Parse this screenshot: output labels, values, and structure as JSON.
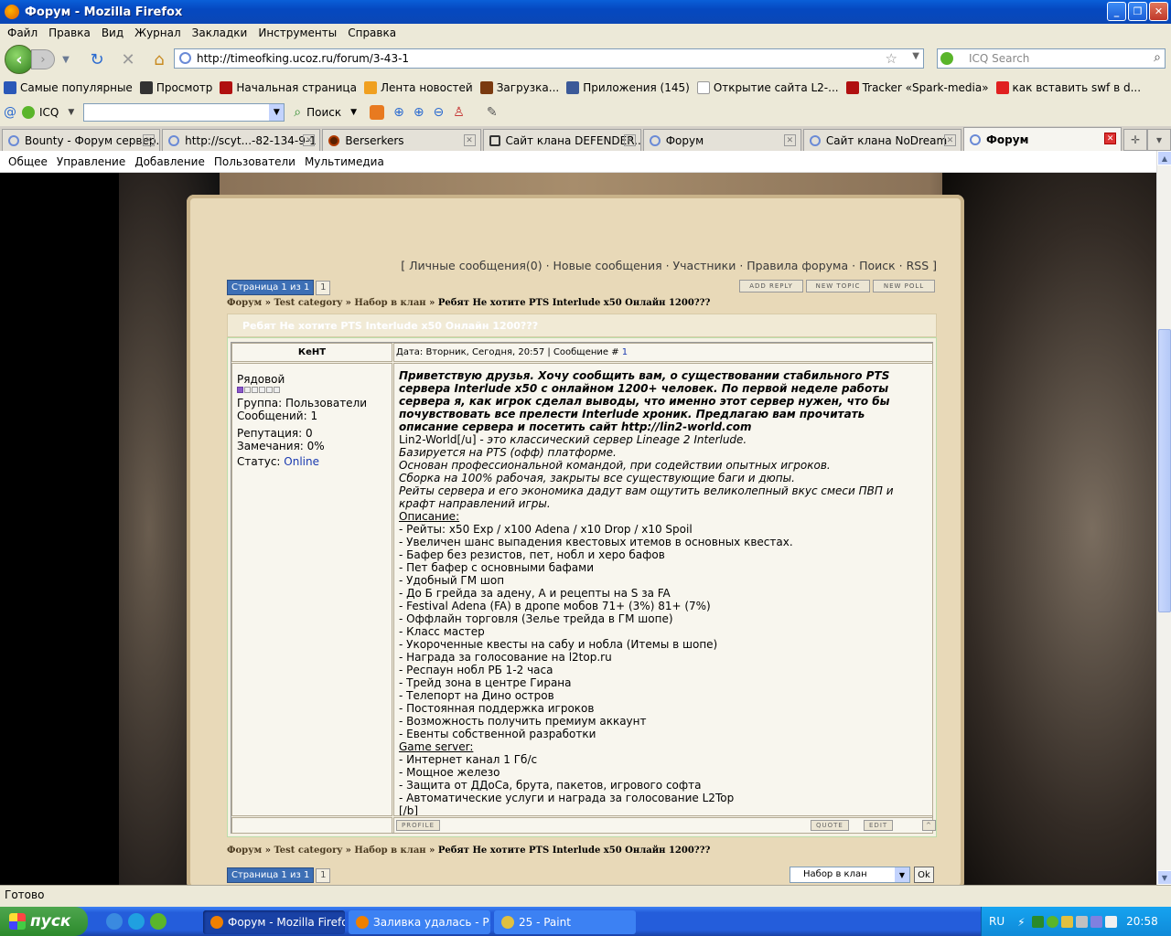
{
  "window": {
    "title": "Форум - Mozilla Firefox"
  },
  "menu": [
    "Файл",
    "Правка",
    "Вид",
    "Журнал",
    "Закладки",
    "Инструменты",
    "Справка"
  ],
  "url": "http://timeofking.ucoz.ru/forum/3-43-1",
  "search_placeholder": "ICQ Search",
  "bookmarks": [
    "Самые популярные",
    "Просмотр",
    "Начальная страница",
    "Лента новостей",
    "Загрузка...",
    "Приложения (145)",
    "Открытие сайта L2-...",
    "Tracker «Spark-media»",
    "как вставить swf в d..."
  ],
  "icqbar": {
    "icq": "ICQ",
    "search": "Поиск"
  },
  "tabs": [
    "Bounty - Форум сервер...",
    "http://scyt...-82-134-9-1",
    "Berserkers",
    "Сайт клана DEFENDER...",
    "Форум",
    "Сайт клана NoDream",
    "Форум"
  ],
  "site_menu": [
    "Общее",
    "Управление",
    "Добавление",
    "Пользователи",
    "Мультимедиа"
  ],
  "forum": {
    "topnav": {
      "open": "[ ",
      "items": [
        "Личные сообщения(0)",
        "Новые сообщения",
        "Участники",
        "Правила форума",
        "Поиск",
        "RSS"
      ],
      "sep": " · ",
      "close": " ]"
    },
    "pager": {
      "label": "Страница 1 из 1",
      "num": "1"
    },
    "buttons": [
      "add reply",
      "new topic",
      "new poll"
    ],
    "crumbs": [
      "Форум",
      "Test category",
      "Набор в клан"
    ],
    "crumb_sep": " » ",
    "thread_title": "Ребят Не хотите PTS Interlude x50 Онлайн 1200???",
    "author": "КеНТ",
    "date_text": "Дата: Вторник, Сегодня, 20:57 | Сообщение # ",
    "msg_num": "1",
    "profile": {
      "rank": "Рядовой",
      "group": "Группа: Пользователи",
      "messages": "Сообщений: 1",
      "rep": "Репутация: 0",
      "warn": "Замечания: 0%",
      "status_label": "Статус: ",
      "status": "Online"
    },
    "intro": "Приветствую друзья. Хочу сообщить вам, о существовании стабильного PTS сервера Interlude x50 с онлайном 1200+ человек. По первой неделе работы сервера я, как игрок сделал выводы, что именно этот сервер нужен, что бы почувствовать все прелести Interlude хроник. Предлагаю вам прочитать описание сервера и посетить сайт http://lin2-world.com",
    "lead": "Lin2-World[/u]",
    "lead_it": " - это классический сервер Lineage 2 Interlude.",
    "italic_lines": [
      "Базируется на PTS (офф) платформе.",
      "Основан профессиональной командой, при содействии опытных игроков.",
      "Сборка на 100% рабочая, закрыты все существующие баги и дюпы.",
      "Рейты сервера и его экономика дадут вам ощутить великолепный вкус смеси ПВП и крафт направлений игры."
    ],
    "desc_head": "Описание:",
    "desc": [
      "- Рейты: x50 Exp / x100 Adena / x10 Drop / x10 Spoil",
      "- Увеличен шанс выпадения квестовых итемов в основных квестах.",
      "- Бафер без резистов, пет, нобл и херо бафов",
      "- Пет бафер с основными бафами",
      "- Удобный ГМ шоп",
      "- До Б грейда за адену, А и рецепты на S за FA",
      "- Festival Adena (FA) в дропе мобов 71+ (3%) 81+ (7%)",
      "- Оффлайн торговля (Зелье трейда в ГМ шопе)",
      "- Класс мастер",
      "- Укороченные квесты на сабу и нобла (Итемы в шопе)",
      "- Награда за голосование на l2top.ru",
      "- Респаун нобл РБ 1-2 часа",
      "- Трейд зона в центре Гирана",
      "- Телепорт на Дино остров",
      "- Постоянная поддержка игроков",
      "- Возможность получить премиум аккаунт",
      "- Евенты собственной разработки"
    ],
    "game_head": "Game server:",
    "game": [
      "- Интернет канал 1 Гб/с",
      "- Мощное железо",
      "- Защита от ДДоСа, брута, пакетов, игрового софта",
      "- Автоматические услуги и награда за голосование L2Top"
    ],
    "closing": "[/b]",
    "post_buttons": {
      "profile": "profile",
      "quote": "quote",
      "edit": "edit",
      "up": "^"
    },
    "jump_select": "Набор в клан",
    "ok": "Ok"
  },
  "status": "Готово",
  "taskbar": {
    "start": "пуск",
    "items": [
      "Форум - Mozilla Firefox",
      "Заливка удалась - Р...",
      "25 - Paint"
    ],
    "lang": "RU",
    "time": "20:58"
  }
}
